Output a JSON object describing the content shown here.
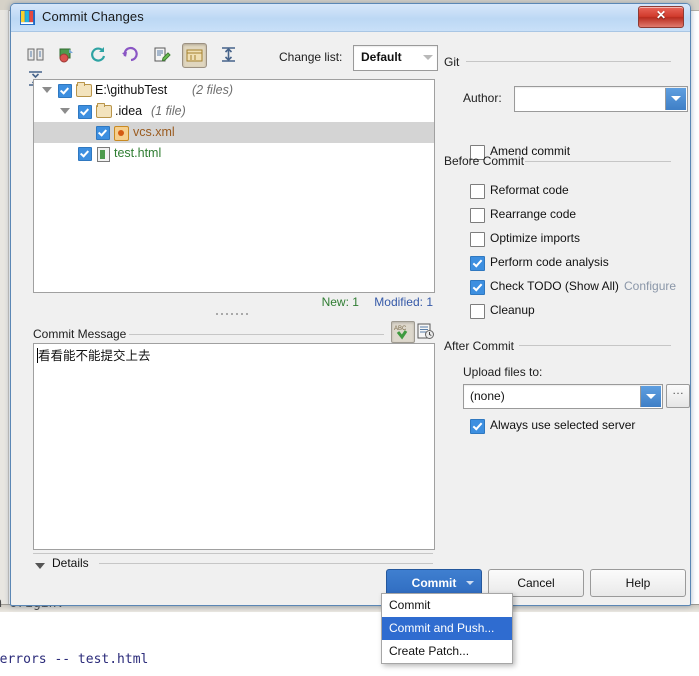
{
  "background": {
    "line_top": "om origin.",
    "line_bottom": "e-errors -- test.html"
  },
  "window": {
    "title": "Commit Changes",
    "title_ghost": "",
    "app_icon": "webstorm-icon",
    "close_label": "✕"
  },
  "toolbar": {
    "icons": [
      {
        "name": "show-diff-icon",
        "pressed": false
      },
      {
        "name": "move-to-changelist-icon",
        "pressed": false
      },
      {
        "name": "refresh-icon",
        "pressed": false
      },
      {
        "name": "revert-icon",
        "pressed": false
      },
      {
        "name": "edit-source-icon",
        "pressed": false
      },
      {
        "name": "group-by-directory-icon",
        "pressed": true
      },
      {
        "name": "expand-all-icon",
        "pressed": false
      },
      {
        "name": "collapse-all-icon",
        "pressed": false
      }
    ],
    "changelist_label": "Change list:",
    "changelist_value": "Default"
  },
  "tree": {
    "nodes": [
      {
        "label": "E:\\githubTest",
        "meta": "(2 files)",
        "icon": "folder-icon",
        "indent": 0,
        "checked": true,
        "expanded": true,
        "selected": false,
        "color": "#111111"
      },
      {
        "label": ".idea",
        "meta": "(1 file)",
        "icon": "folder-icon",
        "indent": 1,
        "checked": true,
        "expanded": true,
        "selected": false,
        "color": "#111111"
      },
      {
        "label": "vcs.xml",
        "meta": "",
        "icon": "xml-file-icon",
        "indent": 2,
        "checked": true,
        "expanded": null,
        "selected": true,
        "color": "#9a5b1f"
      },
      {
        "label": "test.html",
        "meta": "",
        "icon": "html-file-icon",
        "indent": 1,
        "checked": true,
        "expanded": null,
        "selected": false,
        "color": "#2f7d32"
      }
    ],
    "status_new": "New: 1",
    "status_modified": "Modified: 1"
  },
  "commit_message": {
    "label": "Commit Message",
    "label_mnemonic": "C",
    "value": "看看能不能提交上去",
    "placeholder": "",
    "spellcheck_icon": "spellcheck-icon",
    "history_icon": "message-history-icon"
  },
  "details": {
    "label": "Details",
    "expanded": true
  },
  "git_section": {
    "title": "Git",
    "author_label": "Author:",
    "author_value": "",
    "author_placeholder": "",
    "amend_label": "Amend commit",
    "amend_checked": false
  },
  "before_commit": {
    "title": "Before Commit",
    "items": [
      {
        "label": "Reformat code",
        "checked": false
      },
      {
        "label": "Rearrange code",
        "checked": false
      },
      {
        "label": "Optimize imports",
        "checked": false
      },
      {
        "label": "Perform code analysis",
        "checked": true
      },
      {
        "label": "Check TODO (Show All)",
        "checked": true
      }
    ],
    "configure_link": "Configure",
    "cleanup_label": "Cleanup",
    "cleanup_checked": false
  },
  "after_commit": {
    "title": "After Commit",
    "upload_label": "Upload files to:",
    "upload_value": "(none)",
    "browse_label": "…",
    "always_label": "Always use selected server",
    "always_checked": true
  },
  "buttons": {
    "commit": "Commit",
    "cancel": "Cancel",
    "help": "Help"
  },
  "commit_menu": {
    "items": [
      {
        "label": "Commit",
        "highlighted": false
      },
      {
        "label": "Commit and Push...",
        "highlighted": true
      },
      {
        "label": "Create Patch...",
        "highlighted": false
      }
    ]
  },
  "colors": {
    "accent": "#2f6cc0",
    "selection": "#2f6cd0",
    "checkbox_on": "#3d8fe0",
    "new_file": "#2f7d32",
    "modified_file": "#3559a8",
    "title_bar": "#bcd8f4",
    "close_button": "#d03b2c"
  }
}
